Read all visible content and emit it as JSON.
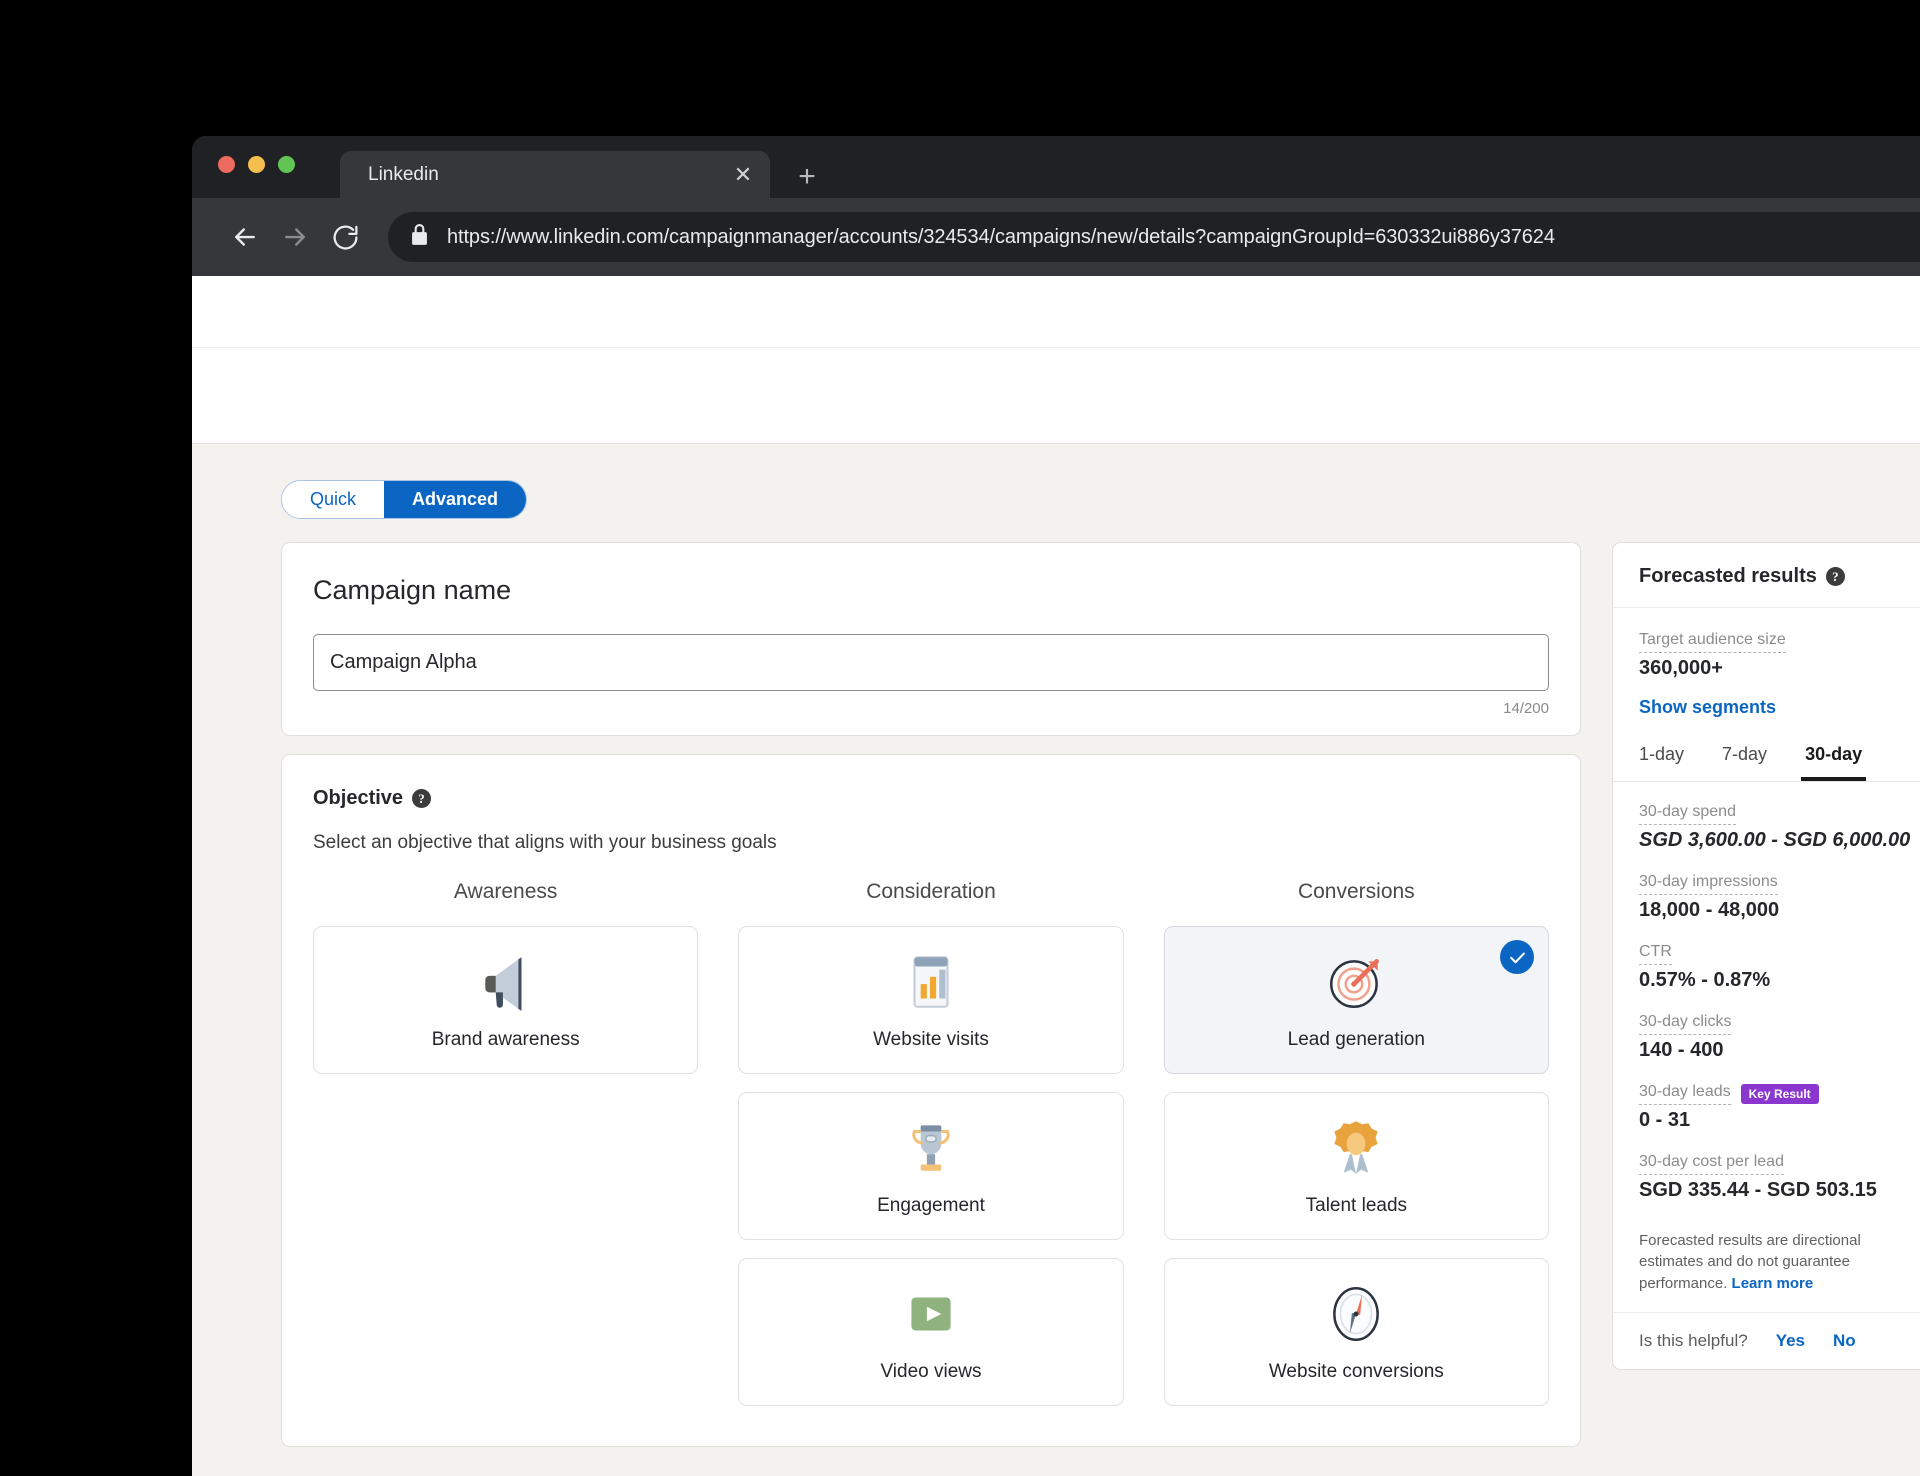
{
  "browser": {
    "tab_title": "Linkedin",
    "close_icon": "close-icon",
    "new_tab_icon": "plus-icon",
    "back_icon": "arrow-left-icon",
    "forward_icon": "arrow-right-icon",
    "reload_icon": "reload-icon",
    "lock_icon": "lock-icon",
    "url": "https://www.linkedin.com/campaignmanager/accounts/324534/campaigns/new/details?campaignGroupId=630332ui886y37624"
  },
  "mode_toggle": {
    "quick_label": "Quick",
    "advanced_label": "Advanced",
    "selected": "Advanced"
  },
  "campaign_name": {
    "label": "Campaign name",
    "value": "Campaign Alpha",
    "placeholder": "Campaign name",
    "counter": "14/200"
  },
  "objective": {
    "title": "Objective",
    "help_icon": "question-mark-icon",
    "subtitle": "Select an objective that aligns with your business goals",
    "columns": [
      {
        "heading": "Awareness",
        "cards": [
          {
            "label": "Brand awareness",
            "icon": "megaphone-icon",
            "selected": false
          }
        ]
      },
      {
        "heading": "Consideration",
        "cards": [
          {
            "label": "Website visits",
            "icon": "bar-chart-window-icon",
            "selected": false
          },
          {
            "label": "Engagement",
            "icon": "trophy-icon",
            "selected": false
          },
          {
            "label": "Video views",
            "icon": "video-play-icon",
            "selected": false
          }
        ]
      },
      {
        "heading": "Conversions",
        "cards": [
          {
            "label": "Lead generation",
            "icon": "target-dart-icon",
            "selected": true
          },
          {
            "label": "Talent leads",
            "icon": "award-ribbon-icon",
            "selected": false
          },
          {
            "label": "Website conversions",
            "icon": "compass-icon",
            "selected": false
          }
        ]
      }
    ]
  },
  "forecast": {
    "title": "Forecasted results",
    "help_icon": "question-mark-icon",
    "audience_label": "Target audience size",
    "audience_value": "360,000+",
    "show_segments_label": "Show segments",
    "tabs": [
      {
        "label": "1-day",
        "active": false
      },
      {
        "label": "7-day",
        "active": false
      },
      {
        "label": "30-day",
        "active": true
      }
    ],
    "metrics": [
      {
        "label": "30-day spend",
        "value": "SGD 3,600.00 - SGD 6,000.00",
        "italic": true,
        "badge": null
      },
      {
        "label": "30-day impressions",
        "value": "18,000 - 48,000",
        "italic": false,
        "badge": null
      },
      {
        "label": "CTR",
        "value": "0.57% - 0.87%",
        "italic": false,
        "badge": null
      },
      {
        "label": "30-day clicks",
        "value": "140 - 400",
        "italic": false,
        "badge": null
      },
      {
        "label": "30-day leads",
        "value": "0 - 31",
        "italic": false,
        "badge": "Key Result"
      },
      {
        "label": "30-day cost per lead",
        "value": "SGD 335.44 - SGD 503.15",
        "italic": false,
        "badge": null
      }
    ],
    "disclaimer": "Forecasted results are directional estimates and do not guarantee performance.",
    "learn_more_label": "Learn more",
    "helpful_question": "Is this helpful?",
    "helpful_yes": "Yes",
    "helpful_no": "No"
  },
  "colors": {
    "linkedin_blue": "#0a66c2",
    "page_background": "#f3f2ef",
    "key_result_purple": "#8b36cf",
    "browser_chrome": "#35373b"
  }
}
